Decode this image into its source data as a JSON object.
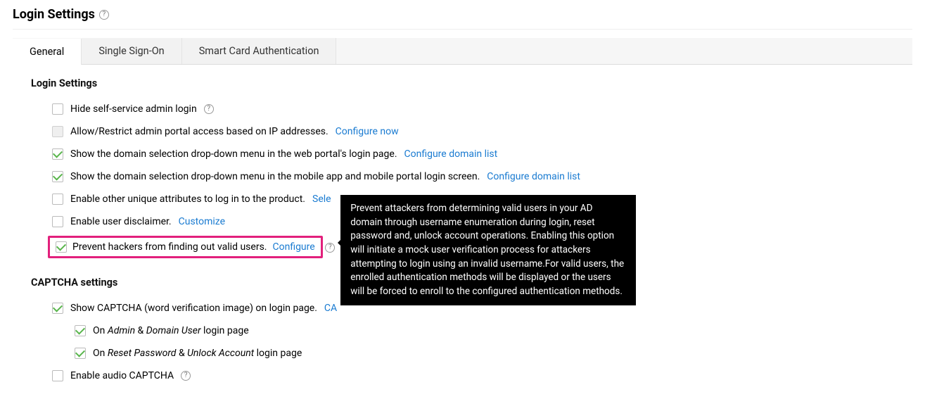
{
  "page_title": "Login Settings",
  "tabs": [
    {
      "label": "General",
      "active": true
    },
    {
      "label": "Single Sign-On",
      "active": false
    },
    {
      "label": "Smart Card Authentication",
      "active": false
    }
  ],
  "sections": {
    "login": {
      "heading": "Login Settings",
      "rows": {
        "hide_admin": {
          "checked": false,
          "label": "Hide self-service admin login"
        },
        "ip_restrict": {
          "checked": false,
          "disabled": true,
          "label": "Allow/Restrict admin portal access based on IP addresses.",
          "link": "Configure now"
        },
        "domain_web": {
          "checked": true,
          "label": "Show the domain selection drop-down menu in the web portal's login page.",
          "link": "Configure domain list"
        },
        "domain_mobile": {
          "checked": true,
          "label": "Show the domain selection drop-down menu in the mobile app and mobile portal login screen.",
          "link": "Configure domain list"
        },
        "unique_attr": {
          "checked": false,
          "label": "Enable other unique attributes to log in to the product.",
          "link_truncated": "Sele"
        },
        "disclaimer": {
          "checked": false,
          "label": "Enable user disclaimer.",
          "link": "Customize"
        },
        "prevent_hackers": {
          "checked": true,
          "label": "Prevent hackers from finding out valid users.",
          "link": "Configure"
        }
      }
    },
    "captcha": {
      "heading": "CAPTCHA settings",
      "rows": {
        "show_captcha": {
          "checked": true,
          "label": "Show CAPTCHA (word verification image) on login page.",
          "link_truncated": "CA"
        },
        "on_admin": {
          "checked": true,
          "prefix": "On ",
          "em1": "Admin",
          "mid": " & ",
          "em2": "Domain User",
          "suffix": " login page"
        },
        "on_reset": {
          "checked": true,
          "prefix": "On ",
          "em1": "Reset Password",
          "mid": " & ",
          "em2": "Unlock Account",
          "suffix": " login page"
        },
        "audio": {
          "checked": false,
          "label": "Enable audio CAPTCHA"
        }
      }
    }
  },
  "tooltip": "Prevent attackers from determining valid users in your AD domain through username enumeration during login, reset password and, unlock account operations. Enabling this option will initiate a mock user verification process for attackers attempting to login using an invalid username.For valid users, the enrolled authentication methods will be displayed or the users will be forced to enroll to the configured authentication methods."
}
